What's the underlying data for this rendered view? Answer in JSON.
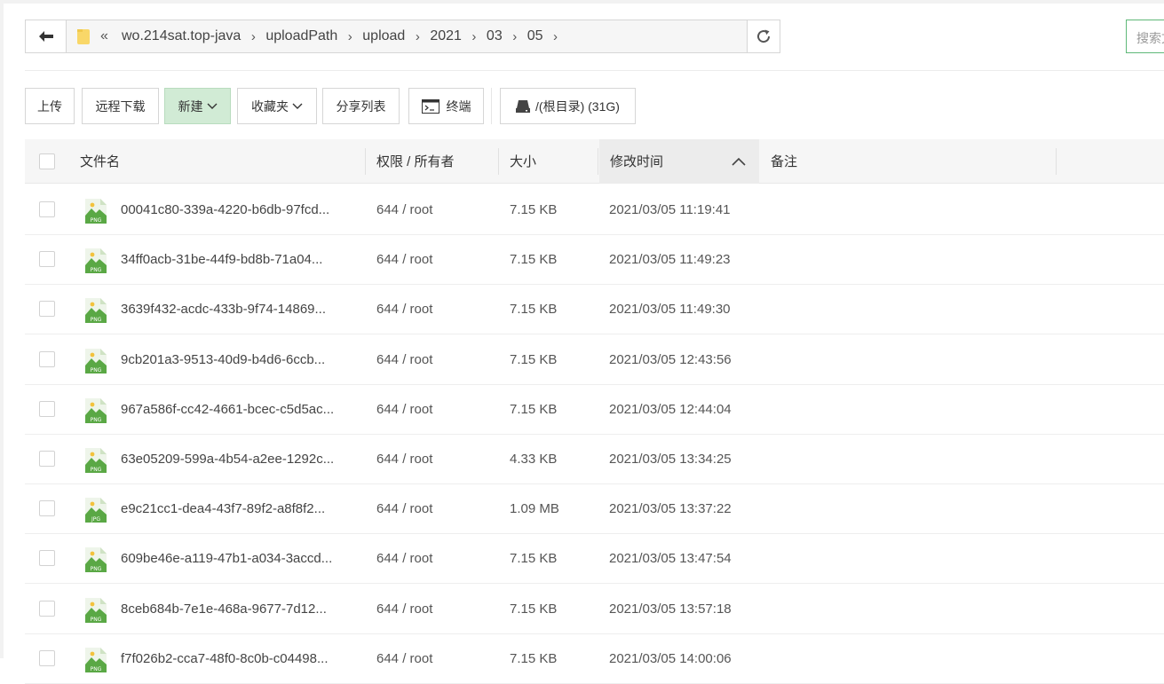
{
  "path": {
    "crumbs": [
      "wo.214sat.top-java",
      "uploadPath",
      "upload",
      "2021",
      "03",
      "05"
    ]
  },
  "search": {
    "placeholder": "搜索文件"
  },
  "toolbar": {
    "upload": "上传",
    "remote_download": "远程下载",
    "new": "新建",
    "favorites": "收藏夹",
    "share_list": "分享列表",
    "terminal": "终端",
    "disk": "/(根目录) (31G)"
  },
  "table": {
    "headers": {
      "name": "文件名",
      "perm": "权限 / 所有者",
      "size": "大小",
      "mtime": "修改时间",
      "note": "备注"
    },
    "sort": {
      "column": "修改时间",
      "direction": "ascending"
    },
    "rows": [
      {
        "name": "00041c80-339a-4220-b6db-97fcd...",
        "type": "PNG",
        "perm": "644 / root",
        "size": "7.15 KB",
        "mtime": "2021/03/05 11:19:41"
      },
      {
        "name": "34ff0acb-31be-44f9-bd8b-71a04...",
        "type": "PNG",
        "perm": "644 / root",
        "size": "7.15 KB",
        "mtime": "2021/03/05 11:49:23"
      },
      {
        "name": "3639f432-acdc-433b-9f74-14869...",
        "type": "PNG",
        "perm": "644 / root",
        "size": "7.15 KB",
        "mtime": "2021/03/05 11:49:30"
      },
      {
        "name": "9cb201a3-9513-40d9-b4d6-6ccb...",
        "type": "PNG",
        "perm": "644 / root",
        "size": "7.15 KB",
        "mtime": "2021/03/05 12:43:56"
      },
      {
        "name": "967a586f-cc42-4661-bcec-c5d5ac...",
        "type": "PNG",
        "perm": "644 / root",
        "size": "7.15 KB",
        "mtime": "2021/03/05 12:44:04"
      },
      {
        "name": "63e05209-599a-4b54-a2ee-1292c...",
        "type": "PNG",
        "perm": "644 / root",
        "size": "4.33 KB",
        "mtime": "2021/03/05 13:34:25"
      },
      {
        "name": "e9c21cc1-dea4-43f7-89f2-a8f8f2...",
        "type": "JPG",
        "perm": "644 / root",
        "size": "1.09 MB",
        "mtime": "2021/03/05 13:37:22"
      },
      {
        "name": "609be46e-a119-47b1-a034-3accd...",
        "type": "PNG",
        "perm": "644 / root",
        "size": "7.15 KB",
        "mtime": "2021/03/05 13:47:54"
      },
      {
        "name": "8ceb684b-7e1e-468a-9677-7d12...",
        "type": "PNG",
        "perm": "644 / root",
        "size": "7.15 KB",
        "mtime": "2021/03/05 13:57:18"
      },
      {
        "name": "f7f026b2-cca7-48f0-8c0b-c04498...",
        "type": "PNG",
        "perm": "644 / root",
        "size": "7.15 KB",
        "mtime": "2021/03/05 14:00:06"
      }
    ]
  },
  "colors": {
    "accent_green": "#20a53a",
    "new_button_bg": "#d1ebd5",
    "folder_yellow": "#f9d768"
  }
}
